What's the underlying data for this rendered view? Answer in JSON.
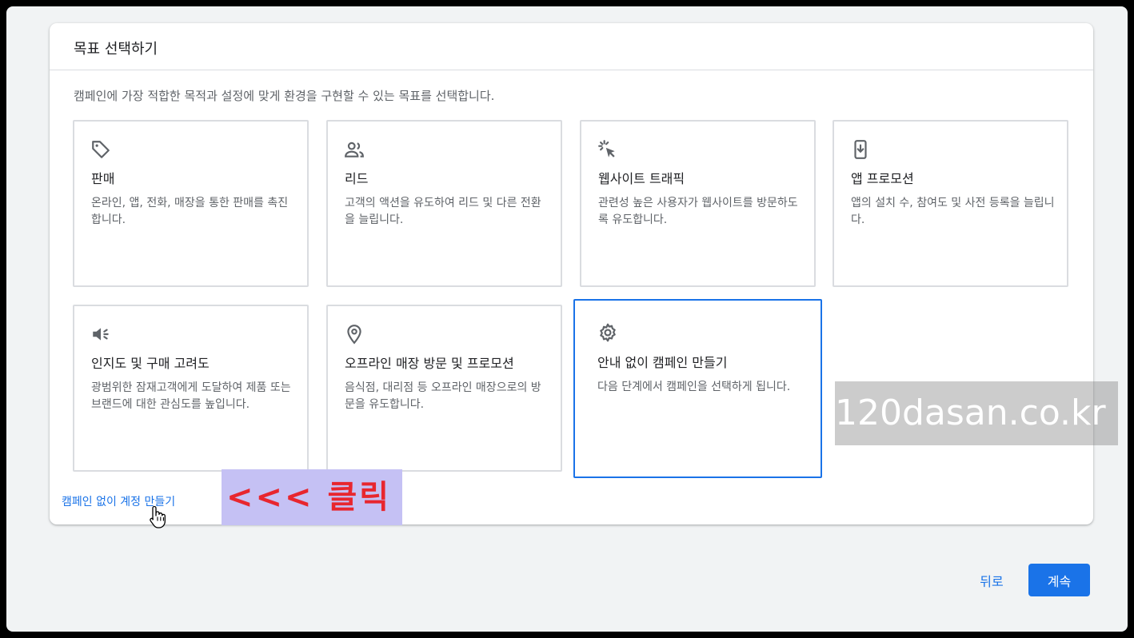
{
  "panel": {
    "title": "목표 선택하기",
    "description": "캠페인에 가장 적합한 목적과 설정에 맞게 환경을 구현할 수 있는 목표를 선택합니다."
  },
  "goals": [
    {
      "icon": "tag-icon",
      "title": "판매",
      "description": "온라인, 앱, 전화, 매장을 통한 판매를 촉진합니다."
    },
    {
      "icon": "people-icon",
      "title": "리드",
      "description": "고객의 액션을 유도하여 리드 및 다른 전환을 늘립니다."
    },
    {
      "icon": "cursor-click-icon",
      "title": "웹사이트 트래픽",
      "description": "관련성 높은 사용자가 웹사이트를 방문하도록 유도합니다."
    },
    {
      "icon": "phone-download-icon",
      "title": "앱 프로모션",
      "description": "앱의 설치 수, 참여도 및 사전 등록을 늘립니다."
    },
    {
      "icon": "speaker-icon",
      "title": "인지도 및 구매 고려도",
      "description": "광범위한 잠재고객에게 도달하여 제품 또는 브랜드에 대한 관심도를 높입니다."
    },
    {
      "icon": "location-pin-icon",
      "title": "오프라인 매장 방문 및 프로모션",
      "description": "음식점, 대리점 등 오프라인 매장으로의 방문을 유도합니다."
    },
    {
      "icon": "gear-icon",
      "title": "안내 없이 캠페인 만들기",
      "description": "다음 단계에서 캠페인을 선택하게 됩니다."
    }
  ],
  "selected_goal": "안내 없이 캠페인 만들기",
  "links": {
    "create_account_without_campaign": "캠페인 없이 계정 만들기"
  },
  "annotation": {
    "text": "<<< 클릭"
  },
  "watermark": "120dasan.co.kr",
  "footer": {
    "back_label": "뒤로",
    "continue_label": "계속"
  },
  "colors": {
    "primary": "#1a73e8",
    "annotation_bg": "#c5c1f4",
    "annotation_text": "#e8262e"
  }
}
